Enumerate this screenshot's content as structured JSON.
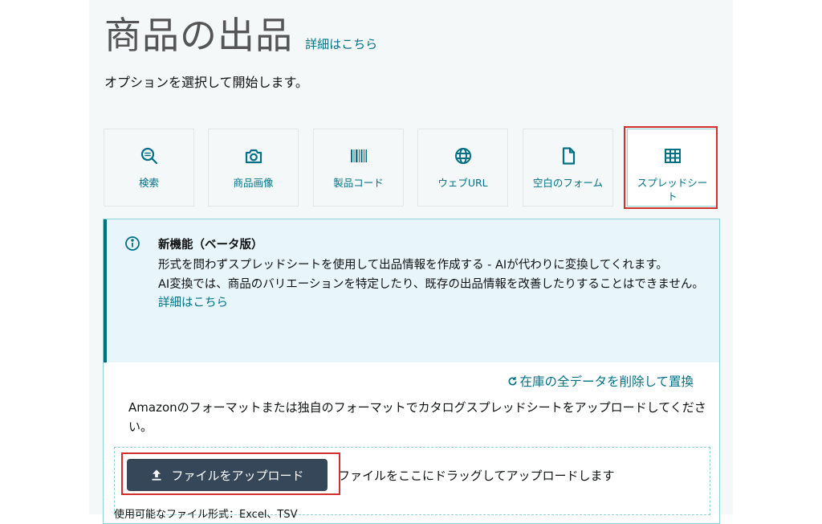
{
  "header": {
    "title": "商品の出品",
    "learn_more": "詳細はこちら",
    "subtitle": "オプションを選択して開始します。"
  },
  "options": [
    {
      "label": "検索",
      "icon": "search-icon"
    },
    {
      "label": "商品画像",
      "icon": "camera-icon"
    },
    {
      "label": "製品コード",
      "icon": "barcode-icon"
    },
    {
      "label": "ウェブURL",
      "icon": "globe-icon"
    },
    {
      "label": "空白のフォーム",
      "icon": "document-icon"
    },
    {
      "label": "スプレッドシート",
      "icon": "spreadsheet-icon",
      "selected": true
    }
  ],
  "alert": {
    "title": "新機能（ベータ版）",
    "line1": "形式を問わずスプレッドシートを使用して出品情報を作成する - AIが代わりに変換してくれます。",
    "line2": "AI変換では、商品のバリエーションを特定したり、既存の出品情報を改善したりすることはできません。",
    "link": "詳細はこちら"
  },
  "replace_link": "在庫の全データを削除して置換",
  "description": "Amazonのフォーマットまたは独自のフォーマットでカタログスプレッドシートをアップロードしてください。",
  "upload": {
    "button_label": "ファイルをアップロード",
    "drop_text": "ファイルをここにドラッグしてアップロードします",
    "formats": "使用可能なファイル形式：Excel、TSV"
  },
  "colors": {
    "accent": "#007185",
    "button_bg": "#37475a",
    "alert_bg": "#e8f5fb",
    "highlight": "#d0312d"
  }
}
